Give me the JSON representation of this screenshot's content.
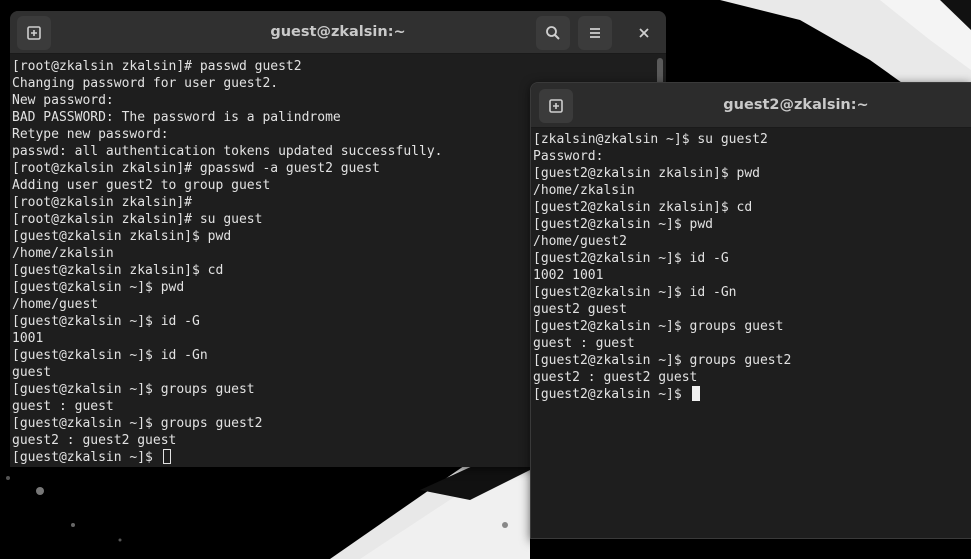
{
  "colors": {
    "terminal_bg": "#1e1e1e",
    "headerbar_bg": "#303030",
    "text": "#e2e2e2",
    "title_text": "#c9c9c9"
  },
  "left_terminal": {
    "title": "guest@zkalsin:~",
    "new_tab_icon": "new-tab-icon",
    "search_icon": "search-icon",
    "menu_icon": "hamburger-menu-icon",
    "close_icon": "close-icon",
    "lines": [
      "[root@zkalsin zkalsin]# passwd guest2",
      "Changing password for user guest2.",
      "New password:",
      "BAD PASSWORD: The password is a palindrome",
      "Retype new password:",
      "passwd: all authentication tokens updated successfully.",
      "[root@zkalsin zkalsin]# gpasswd -a guest2 guest",
      "Adding user guest2 to group guest",
      "[root@zkalsin zkalsin]#",
      "[root@zkalsin zkalsin]# su guest",
      "[guest@zkalsin zkalsin]$ pwd",
      "/home/zkalsin",
      "[guest@zkalsin zkalsin]$ cd",
      "[guest@zkalsin ~]$ pwd",
      "/home/guest",
      "[guest@zkalsin ~]$ id -G",
      "1001",
      "[guest@zkalsin ~]$ id -Gn",
      "guest",
      "[guest@zkalsin ~]$ groups guest",
      "guest : guest",
      "[guest@zkalsin ~]$ groups guest2",
      "guest2 : guest2 guest"
    ],
    "prompt": "[guest@zkalsin ~]$ "
  },
  "right_terminal": {
    "title": "guest2@zkalsin:~",
    "new_tab_icon": "new-tab-icon",
    "lines": [
      "[zkalsin@zkalsin ~]$ su guest2",
      "Password:",
      "[guest2@zkalsin zkalsin]$ pwd",
      "/home/zkalsin",
      "[guest2@zkalsin zkalsin]$ cd",
      "[guest2@zkalsin ~]$ pwd",
      "/home/guest2",
      "[guest2@zkalsin ~]$ id -G",
      "1002 1001",
      "[guest2@zkalsin ~]$ id -Gn",
      "guest2 guest",
      "[guest2@zkalsin ~]$ groups guest",
      "guest : guest",
      "[guest2@zkalsin ~]$ groups guest2",
      "guest2 : guest2 guest"
    ],
    "prompt": "[guest2@zkalsin ~]$ "
  }
}
